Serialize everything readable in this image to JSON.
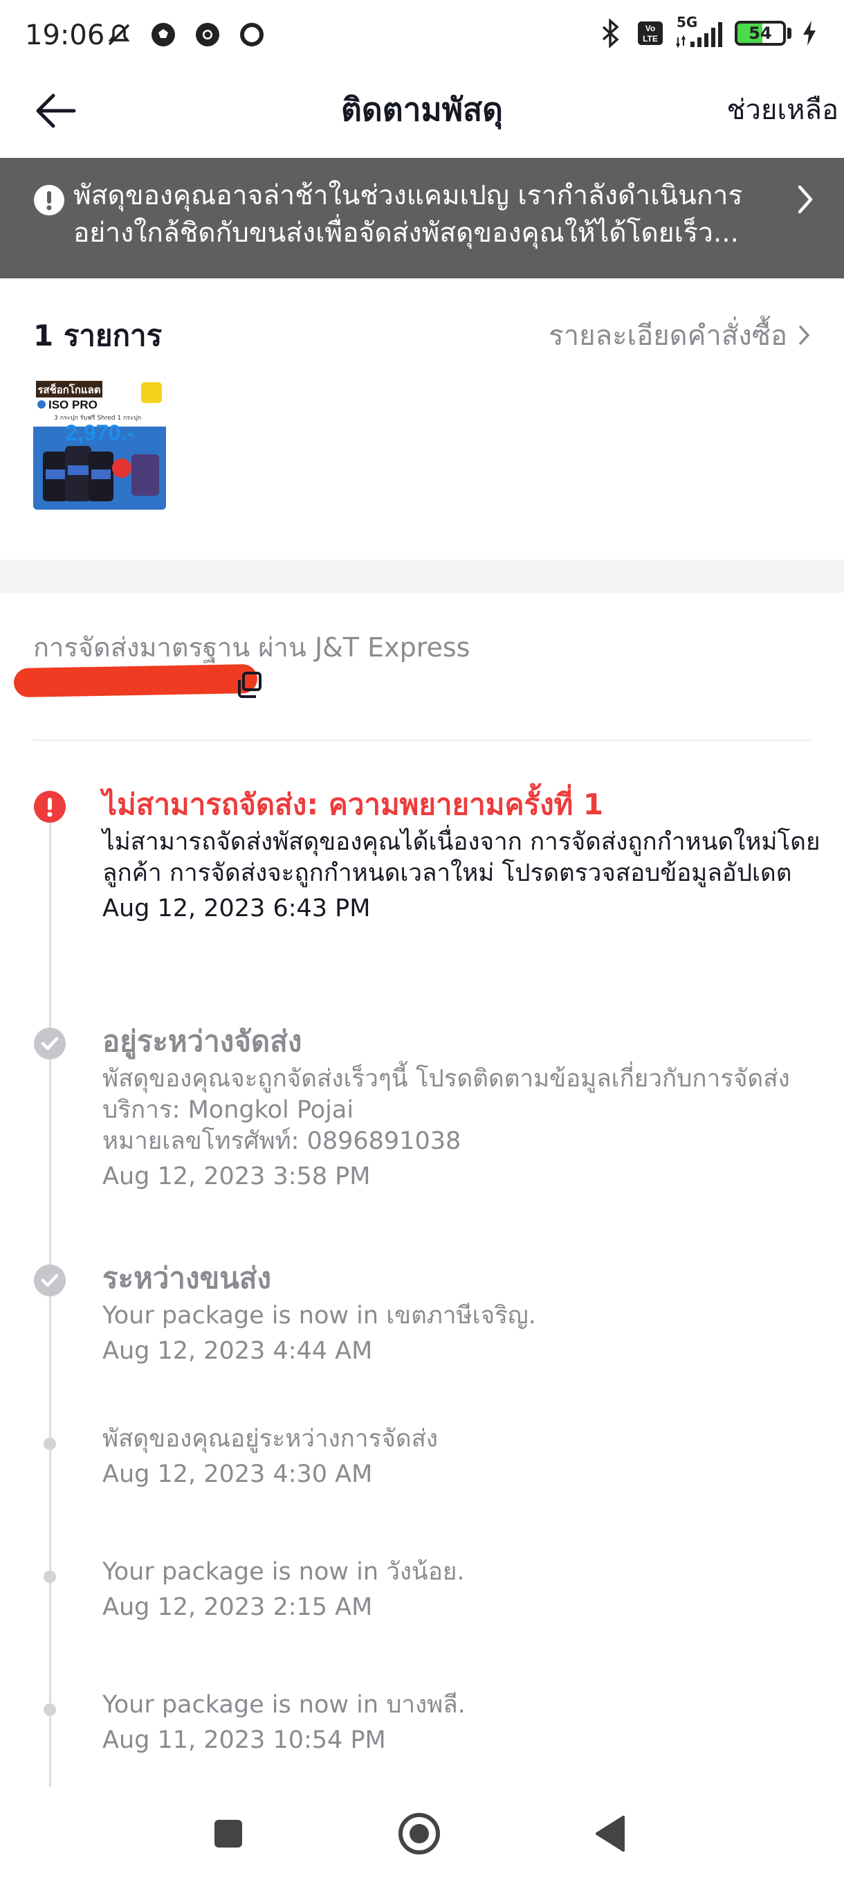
{
  "status_bar": {
    "time": "19:06",
    "network": "5G",
    "battery_level": 54,
    "battery_label": "54",
    "battery_color": "#4cd94c",
    "left_icons": [
      "mute-icon",
      "soccer-ball-icon",
      "chrome-icon",
      "ring-icon"
    ],
    "right_icons": [
      "bluetooth-icon",
      "volte-icon",
      "signal-icon",
      "battery-icon",
      "charging-icon"
    ]
  },
  "header": {
    "title": "ติดตามพัสดุ",
    "help_label": "ช่วยเหลือ"
  },
  "banner": {
    "text": "พัสดุของคุณอาจล่าช้าในช่วงแคมเปญ เรากำลังดำเนินการอย่างใกล้ชิดกับขนส่งเพื่อจัดส่งพัสดุของคุณให้ได้โดยเร็ว...",
    "background": "#5f5f5f"
  },
  "items": {
    "count_label": "1 รายการ",
    "order_details_label": "รายละเอียดคำสั่งซื้อ",
    "product": {
      "badge_text": "รสช็อกโกแลต",
      "name": "ISO PRO",
      "subtitle": "3 กระปุก รับฟรี Shred 1 กระปุก",
      "price": "2,970.-"
    }
  },
  "shipping": {
    "method": "การจัดส่งมาตรฐาน ผ่าน J&T Express",
    "tracking_number": "redacted"
  },
  "timeline": [
    {
      "status": "alert",
      "title": "ไม่สามารถจัดส่ง: ความพยายามครั้งที่ 1",
      "description": "ไม่สามารถจัดส่งพัสดุของคุณได้เนื่องจาก การจัดส่งถูกกำหนดใหม่โดยลูกค้า การจัดส่งจะถูกกำหนดเวลาใหม่ โปรดตรวจสอบข้อมูลอัปเดต",
      "time": "Aug 12, 2023 6:43 PM"
    },
    {
      "status": "check",
      "title": "อยู่ระหว่างจัดส่ง",
      "description": "พัสดุของคุณจะถูกจัดส่งเร็วๆนี้ โปรดติดตามข้อมูลเกี่ยวกับการจัดส่ง",
      "courier_line": "บริการ: Mongkol Pojai",
      "phone_line": "หมายเลขโทรศัพท์: 0896891038",
      "time": "Aug 12, 2023 3:58 PM"
    },
    {
      "status": "check",
      "title": "ระหว่างขนส่ง",
      "description": "Your package is now in เขตภาษีเจริญ.",
      "time": "Aug 12, 2023 4:44 AM"
    },
    {
      "status": "dot",
      "description": "พัสดุของคุณอยู่ระหว่างการจัดส่ง",
      "time": "Aug 12, 2023 4:30 AM"
    },
    {
      "status": "dot",
      "description": "Your package is now in วังน้อย.",
      "time": "Aug 12, 2023 2:15 AM"
    },
    {
      "status": "dot",
      "description": "Your package is now in บางพลี.",
      "time": "Aug 11, 2023 10:54 PM"
    }
  ],
  "colors": {
    "alert": "#ee3b3b",
    "muted_text": "#8a8b91",
    "primary_text": "#161823",
    "redaction": "#ee3b21"
  }
}
